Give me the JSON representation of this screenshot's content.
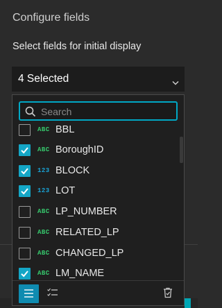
{
  "panel": {
    "heading": "Configure fields",
    "subheading": "Select fields for initial display"
  },
  "select": {
    "value": "4 Selected",
    "chevron_icon": "chevron-down-icon"
  },
  "search": {
    "placeholder": "Search",
    "icon": "search-icon"
  },
  "fields": [
    {
      "type": "ABC",
      "name": "BBL",
      "checked": false
    },
    {
      "type": "ABC",
      "name": "BoroughID",
      "checked": true
    },
    {
      "type": "123",
      "name": "BLOCK",
      "checked": true
    },
    {
      "type": "123",
      "name": "LOT",
      "checked": true
    },
    {
      "type": "ABC",
      "name": "LP_NUMBER",
      "checked": false
    },
    {
      "type": "ABC",
      "name": "RELATED_LP",
      "checked": false
    },
    {
      "type": "ABC",
      "name": "CHANGED_LP",
      "checked": false
    },
    {
      "type": "ABC",
      "name": "LM_NAME",
      "checked": true
    }
  ],
  "footer": {
    "list_icon": "list-icon",
    "checklist_icon": "checklist-icon",
    "trash_icon": "trash-icon"
  },
  "colors": {
    "accent": "#14a6c6",
    "abc_type": "#36c96d",
    "number_type": "#19a3d6"
  }
}
